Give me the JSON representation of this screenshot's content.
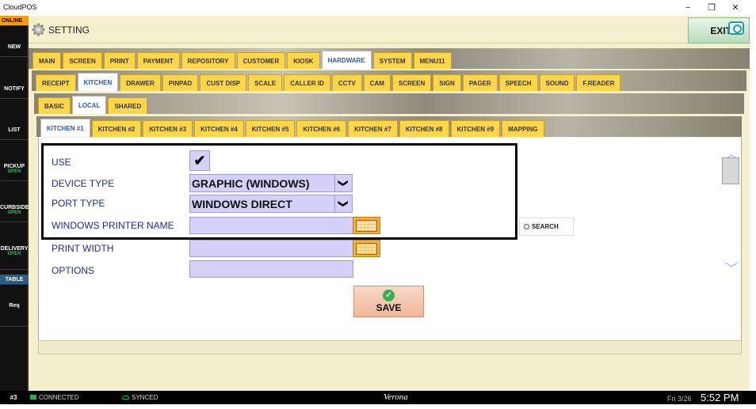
{
  "window": {
    "title": "CloudPOS",
    "min_glyph": "−",
    "restore_glyph": "❐",
    "close_glyph": "✕"
  },
  "sidebar": {
    "online": "ONLINE",
    "items": [
      {
        "label": "NEW",
        "sub": ""
      },
      {
        "label": "NOTIFY",
        "sub": ""
      },
      {
        "label": "LIST",
        "sub": ""
      },
      {
        "label": "PICKUP",
        "sub": "OPEN"
      },
      {
        "label": "CURBSIDE",
        "sub": "OPEN"
      },
      {
        "label": "DELIVERY",
        "sub": "OPEN"
      },
      {
        "label": "TABLE",
        "sub": ""
      },
      {
        "label": "Req",
        "sub": ""
      }
    ]
  },
  "header": {
    "title": "SETTING",
    "exit_label": "EXIT"
  },
  "tabs": {
    "row1": [
      "MAIN",
      "SCREEN",
      "PRINT",
      "PAYMENT",
      "REPOSITORY",
      "CUSTOMER",
      "KIOSK",
      "HARDWARE",
      "SYSTEM",
      "MENU11"
    ],
    "row1_active": "HARDWARE",
    "row2": [
      "RECEIPT",
      "KITCHEN",
      "DRAWER",
      "PINPAD",
      "CUST DISP",
      "SCALE",
      "CALLER ID",
      "CCTV",
      "CAM",
      "SCREEN",
      "SIGN",
      "PAGER",
      "SPEECH",
      "SOUND",
      "F.READER"
    ],
    "row2_active": "KITCHEN",
    "row3": [
      "BASIC",
      "LOCAL",
      "SHARED"
    ],
    "row3_active": "LOCAL",
    "row4": [
      "KITCHEN #1",
      "KITCHEN #2",
      "KITCHEN #3",
      "KITCHEN #4",
      "KITCHEN #5",
      "KITCHEN #6",
      "KITCHEN #7",
      "KITCHEN #8",
      "KITCHEN #9",
      "MAPPING"
    ],
    "row4_active": "KITCHEN #1"
  },
  "form": {
    "use_label": "USE",
    "use_checked": true,
    "check_glyph": "✔",
    "device_type_label": "DEVICE TYPE",
    "device_type_value": "GRAPHIC (WINDOWS)",
    "port_type_label": "PORT TYPE",
    "port_type_value": "WINDOWS DIRECT",
    "printer_name_label": "WINDOWS PRINTER NAME",
    "printer_name_value": "",
    "search_label": "SEARCH",
    "print_width_label": "PRINT WIDTH",
    "print_width_value": "",
    "options_label": "OPTIONS",
    "options_value": "",
    "dropdown_glyph": "❯",
    "save_label": "SAVE",
    "save_glyph": "✓",
    "scroll_up_glyph": "︿",
    "scroll_down_glyph": "﹀"
  },
  "status": {
    "terminal": "#3",
    "connection": "CONNECTED",
    "sync": "SYNCED",
    "location": "Verona",
    "date": "Fri 3/26",
    "time": "5:52 PM"
  }
}
